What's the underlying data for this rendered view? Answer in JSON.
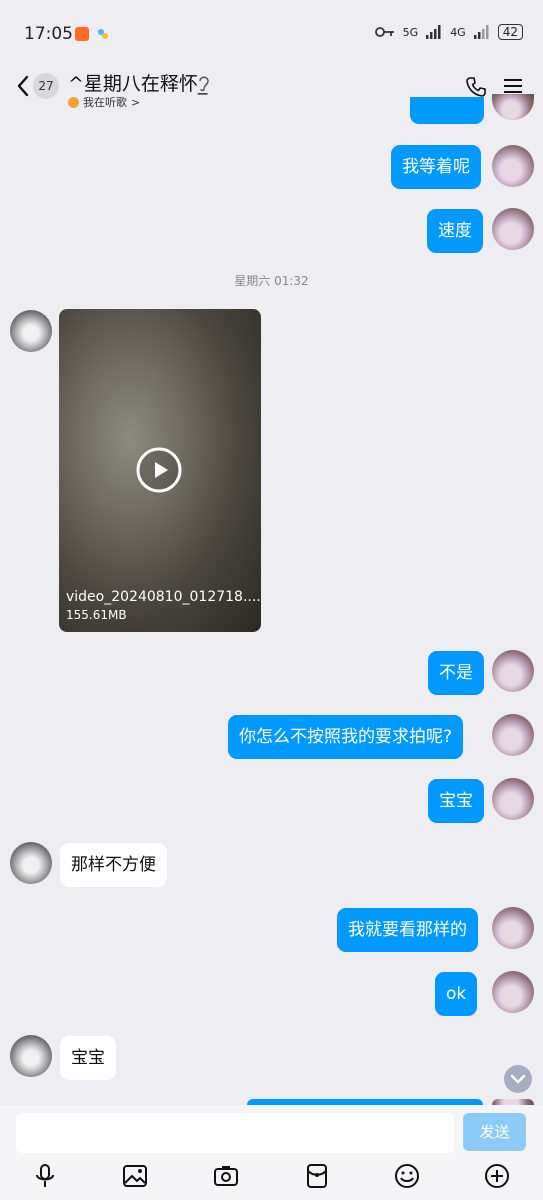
{
  "status": {
    "time": "17:05",
    "signal1": "5G",
    "signal2": "4G",
    "battery": "42"
  },
  "header": {
    "back_count": "27",
    "title": "^星期八在释怀_",
    "subtitle": "我在听歌",
    "subtitle_chevron": ">"
  },
  "messages": {
    "m1": "我等着呢",
    "m2": "速度",
    "timestamp": "星期六 01:32",
    "video_name": "video_20240810_012718....",
    "video_size": "155.61MB",
    "m3": "不是",
    "m4": "你怎么不按照我的要求拍呢?",
    "m5": "宝宝",
    "m6": "那样不方便",
    "m7": "我就要看那样的",
    "m8": "ok",
    "m9": "宝宝"
  },
  "input": {
    "placeholder": "",
    "send_label": "发送"
  },
  "colors": {
    "bubble_out": "#0099FF",
    "bubble_in": "#FFFFFF",
    "background": "#EDEDF2"
  },
  "icons": [
    "voice-icon",
    "image-icon",
    "camera-icon",
    "red-packet-icon",
    "emoji-icon",
    "plus-icon"
  ]
}
